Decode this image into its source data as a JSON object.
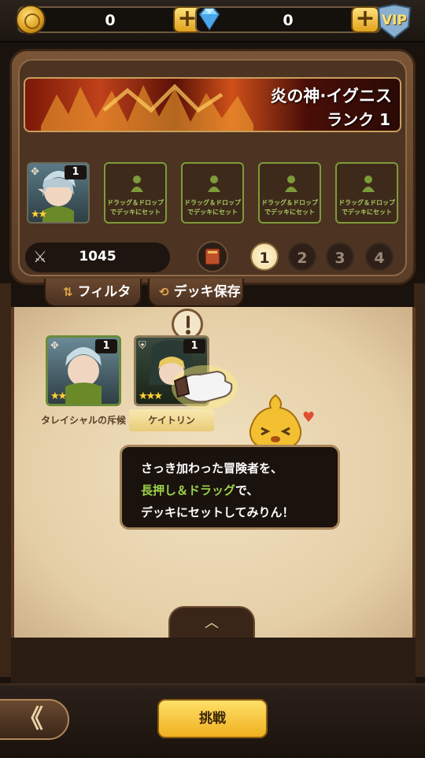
{
  "topbar": {
    "gold": {
      "icon": "gold-coin-icon",
      "value": "0"
    },
    "gems": {
      "icon": "diamond-icon",
      "value": "0"
    },
    "vip_label": "VIP"
  },
  "boss": {
    "name": "炎の神·イグニス",
    "rank": "ランク 1"
  },
  "deck": {
    "hero": {
      "level": "1",
      "stars": "★★"
    },
    "empty_slot_line1": "ドラッグ＆ドロップ",
    "empty_slot_line2": "でデッキにセット",
    "power": "1045",
    "pages": [
      "1",
      "2",
      "3",
      "4"
    ],
    "active_page": "1"
  },
  "tabs": {
    "filter": "フィルタ",
    "save_deck": "デッキ保存"
  },
  "roster": [
    {
      "name": "タレイシャルの斥候",
      "level": "1",
      "stars": "★★",
      "selected": false
    },
    {
      "name": "ケイトリン",
      "level": "1",
      "stars": "★★★",
      "selected": true
    }
  ],
  "tutorial": {
    "line1": "さっき加わった冒険者を、",
    "line2_highlight": "長押し＆ドラッグ",
    "line2_rest": "で、",
    "line3": "デッキにセットしてみりん！"
  },
  "bottom": {
    "back_label": "《",
    "challenge_label": "挑戦"
  },
  "colors": {
    "accent_gold": "#f0b020",
    "highlight_green": "#9ad04a",
    "slot_border": "#7d9b3a"
  }
}
